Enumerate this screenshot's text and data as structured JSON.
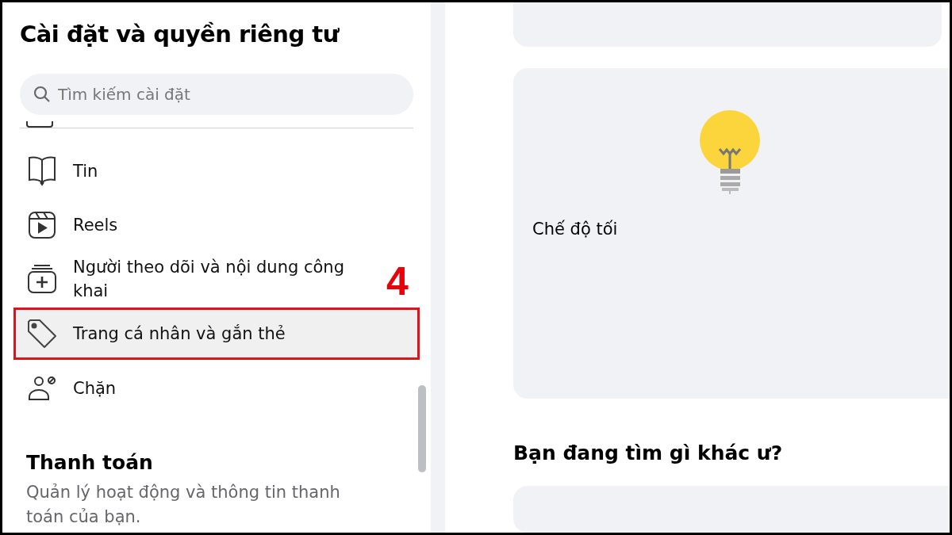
{
  "sidebar": {
    "title": "Cài đặt và quyền riêng tư",
    "search": {
      "placeholder": "Tìm kiếm cài đặt"
    },
    "items": [
      {
        "label": "Tin",
        "selected": false
      },
      {
        "label": "Reels",
        "selected": false
      },
      {
        "label": "Người theo dõi và nội dung công khai",
        "selected": false
      },
      {
        "label": "Trang cá nhân và gắn thẻ",
        "selected": true
      },
      {
        "label": "Chặn",
        "selected": false
      }
    ],
    "step_marker": "4",
    "section": {
      "title": "Thanh toán",
      "description": "Quản lý hoạt động và thông tin thanh toán của bạn."
    }
  },
  "main": {
    "card": {
      "label": "Chế độ tối"
    },
    "heading": "Bạn đang tìm gì khác ư?"
  }
}
